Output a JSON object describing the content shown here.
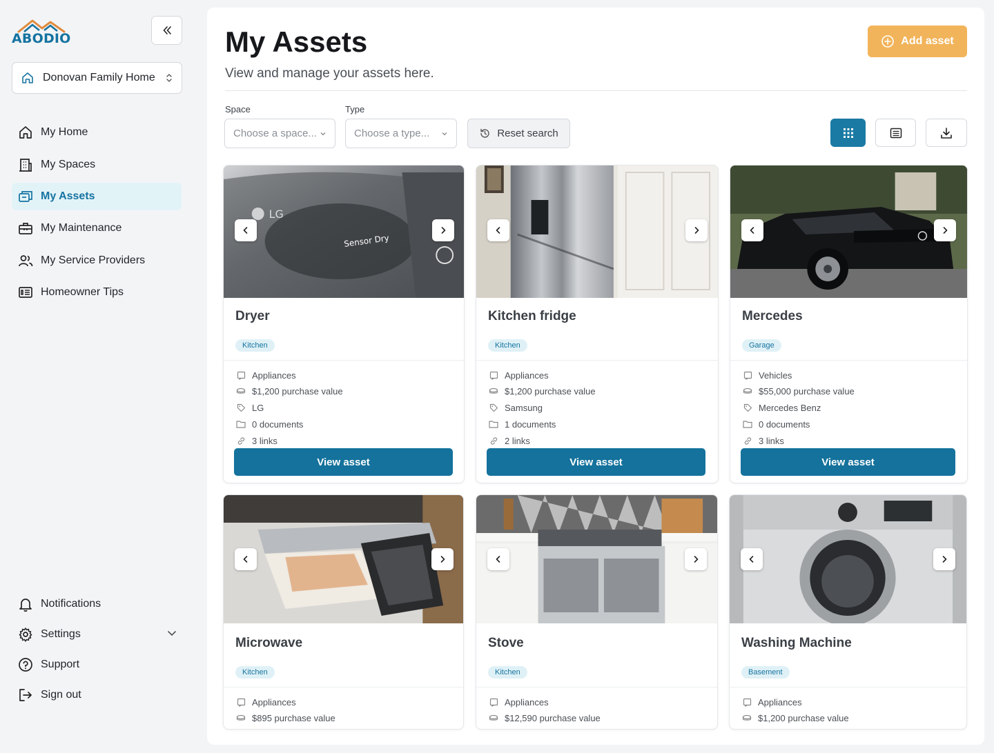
{
  "brand": {
    "name": "ABODIO",
    "accent": "#1573a0",
    "orange": "#e08a3c"
  },
  "sidebar": {
    "home_selector": "Donovan Family Home",
    "nav": [
      {
        "label": "My Home",
        "icon": "house-icon",
        "active": false
      },
      {
        "label": "My Spaces",
        "icon": "building-icon",
        "active": false
      },
      {
        "label": "My Assets",
        "icon": "assets-icon",
        "active": true
      },
      {
        "label": "My Maintenance",
        "icon": "toolbox-icon",
        "active": false
      },
      {
        "label": "My Service Providers",
        "icon": "users-icon",
        "active": false
      },
      {
        "label": "Homeowner Tips",
        "icon": "newspaper-icon",
        "active": false
      }
    ],
    "bottom_nav": [
      {
        "label": "Notifications",
        "icon": "bell-icon"
      },
      {
        "label": "Settings",
        "icon": "gear-icon"
      },
      {
        "label": "Support",
        "icon": "question-circle-icon"
      },
      {
        "label": "Sign out",
        "icon": "sign-out-icon"
      }
    ]
  },
  "header": {
    "title": "My Assets",
    "subtitle": "View and manage your assets here.",
    "add_button": "Add asset"
  },
  "filters": {
    "space_label": "Space",
    "space_placeholder": "Choose a space...",
    "type_label": "Type",
    "type_placeholder": "Choose a type...",
    "reset_label": "Reset search"
  },
  "view_modes": [
    {
      "name": "grid-view",
      "icon": "grid-icon",
      "active": true
    },
    {
      "name": "list-view",
      "icon": "list-icon",
      "active": false
    },
    {
      "name": "download",
      "icon": "download-icon",
      "active": false
    }
  ],
  "assets": [
    {
      "name": "Dryer",
      "space": "Kitchen",
      "type": "Appliances",
      "value": "$1,200 purchase value",
      "brand": "LG",
      "documents": "0 documents",
      "links": "3 links",
      "cta": "View asset"
    },
    {
      "name": "Kitchen fridge",
      "space": "Kitchen",
      "type": "Appliances",
      "value": "$1,200 purchase value",
      "brand": "Samsung",
      "documents": "1 documents",
      "links": "2 links",
      "cta": "View asset"
    },
    {
      "name": "Mercedes",
      "space": "Garage",
      "type": "Vehicles",
      "value": "$55,000 purchase value",
      "brand": "Mercedes Benz",
      "documents": "0 documents",
      "links": "3 links",
      "cta": "View asset"
    },
    {
      "name": "Microwave",
      "space": "Kitchen",
      "type": "Appliances",
      "value": "$895 purchase value"
    },
    {
      "name": "Stove",
      "space": "Kitchen",
      "type": "Appliances",
      "value": "$12,590 purchase value"
    },
    {
      "name": "Washing Machine",
      "space": "Basement",
      "type": "Appliances",
      "value": "$1,200 purchase value"
    }
  ],
  "photo_text": {
    "dryer_brand": "LG",
    "dryer_panel": "Sensor Dry"
  }
}
